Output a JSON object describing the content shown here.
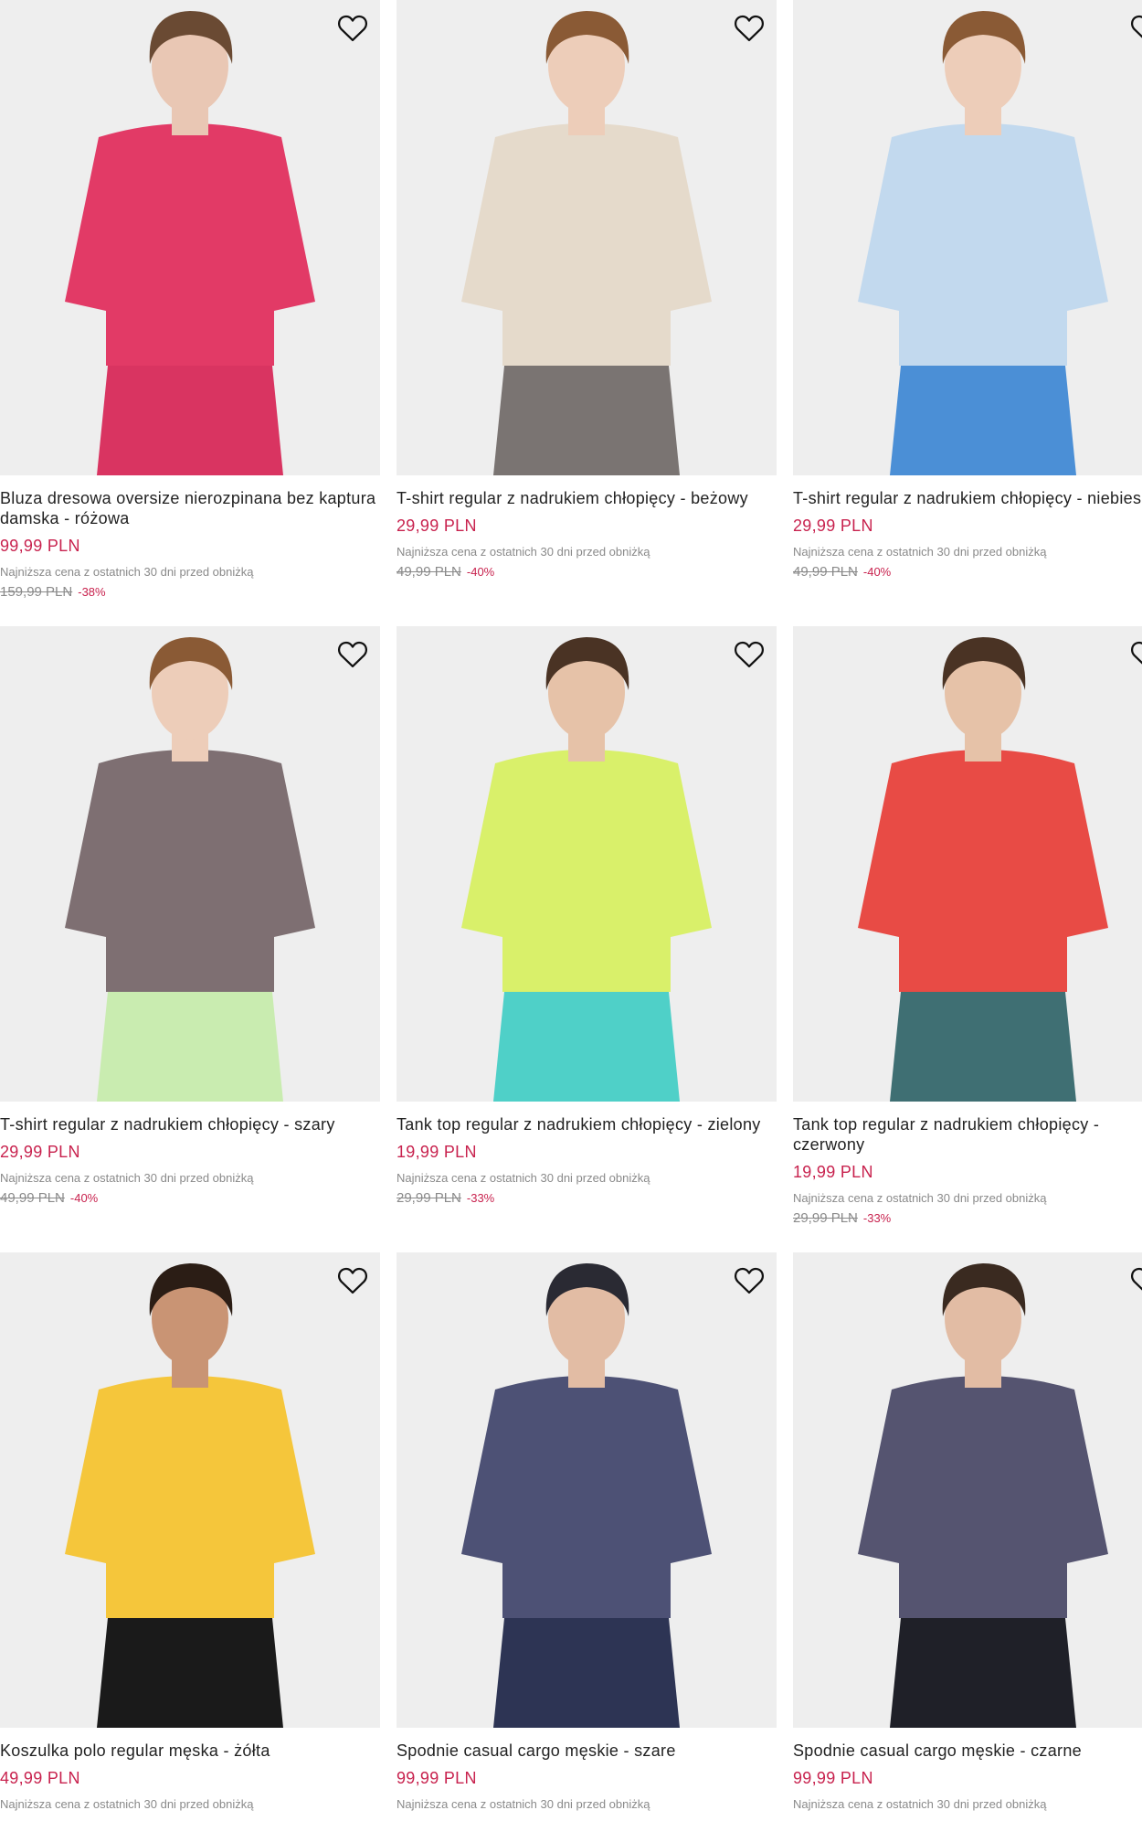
{
  "lowest_price_label": "Najniższa cena z ostatnich 30 dni przed obniżką",
  "accent_color": "#c8224e",
  "wishlist_icon": "heart-icon",
  "products": [
    {
      "name": "Bluza dresowa oversize nierozpinana bez kaptura damska - różowa",
      "price": "99,99 PLN",
      "old_price": "159,99 PLN",
      "discount": "-38%",
      "colors": {
        "top": "#e23a66",
        "bottom": "#d93461",
        "skin": "#e9c7b4",
        "hair": "#6a4a33"
      }
    },
    {
      "name": "T-shirt regular z nadrukiem chłopięcy - beżowy",
      "price": "29,99 PLN",
      "old_price": "49,99 PLN",
      "discount": "-40%",
      "colors": {
        "top": "#e5dacb",
        "bottom": "#7a7472",
        "skin": "#edcdb9",
        "hair": "#8a5a35"
      }
    },
    {
      "name": "T-shirt regular z nadrukiem chłopięcy - niebieski",
      "price": "29,99 PLN",
      "old_price": "49,99 PLN",
      "discount": "-40%",
      "colors": {
        "top": "#c2d9ee",
        "bottom": "#4b8fd6",
        "skin": "#edcdb9",
        "hair": "#8a5a35"
      }
    },
    {
      "name": "T-shirt regular z nadrukiem chłopięcy - szary",
      "price": "29,99 PLN",
      "old_price": "49,99 PLN",
      "discount": "-40%",
      "colors": {
        "top": "#7e6f72",
        "bottom": "#c9ecb0",
        "skin": "#edcdb9",
        "hair": "#8a5a35"
      }
    },
    {
      "name": "Tank top regular z nadrukiem chłopięcy - zielony",
      "price": "19,99 PLN",
      "old_price": "29,99 PLN",
      "discount": "-33%",
      "colors": {
        "top": "#d9f06a",
        "bottom": "#4fd0c8",
        "skin": "#e6c2a8",
        "hair": "#4a3324"
      }
    },
    {
      "name": "Tank top regular z nadrukiem chłopięcy - czerwony",
      "price": "19,99 PLN",
      "old_price": "29,99 PLN",
      "discount": "-33%",
      "colors": {
        "top": "#e84b45",
        "bottom": "#3f6f73",
        "skin": "#e6c2a8",
        "hair": "#4a3324"
      }
    },
    {
      "name": "Koszulka polo regular męska - żółta",
      "price": "49,99 PLN",
      "colors": {
        "top": "#f5c63b",
        "bottom": "#1a1a1a",
        "skin": "#c99474",
        "hair": "#2b1d15"
      }
    },
    {
      "name": "Spodnie casual cargo męskie - szare",
      "price": "99,99 PLN",
      "colors": {
        "top": "#4d5175",
        "bottom": "#2d3454",
        "skin": "#e2bca4",
        "hair": "#2a2a33"
      }
    },
    {
      "name": "Spodnie casual cargo męskie - czarne",
      "price": "99,99 PLN",
      "colors": {
        "top": "#555470",
        "bottom": "#1f2028",
        "skin": "#e2bca4",
        "hair": "#3a2a20"
      }
    }
  ]
}
